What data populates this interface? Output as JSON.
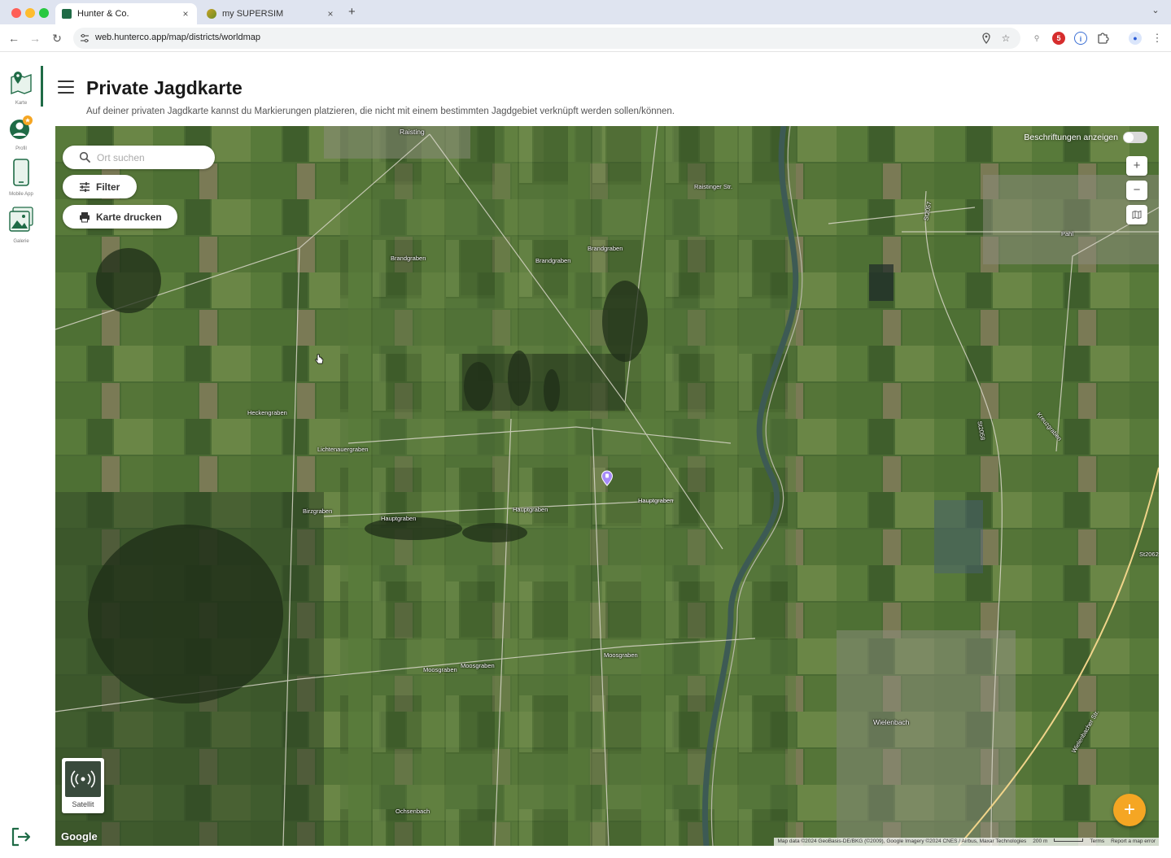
{
  "browser": {
    "tabs": [
      {
        "title": "Hunter & Co.",
        "active": true
      },
      {
        "title": "my SUPERSIM",
        "active": false
      }
    ],
    "new_tab": "+",
    "close_glyph": "×",
    "url": "web.hunterco.app/map/districts/worldmap"
  },
  "sidenav": {
    "items": [
      {
        "label": "Karte",
        "icon": "map-pin-icon",
        "active": true
      },
      {
        "label": "Profil",
        "icon": "user-profile-icon",
        "active": false
      },
      {
        "label": "Mobile App",
        "icon": "smartphone-icon",
        "active": false
      },
      {
        "label": "Galerie",
        "icon": "gallery-icon",
        "active": false
      }
    ],
    "logout_icon": "logout-icon"
  },
  "header": {
    "title": "Private Jagdkarte",
    "description": "Auf deiner privaten Jagdkarte kannst du Markierungen platzieren, die nicht mit einem bestimmten Jagdgebiet verknüpft werden sollen/können."
  },
  "map": {
    "search_placeholder": "Ort suchen",
    "filter_label": "Filter",
    "print_label": "Karte drucken",
    "labels_toggle_label": "Beschriftungen anzeigen",
    "labels_toggle_on": false,
    "zoom_in": "+",
    "zoom_out": "−",
    "layer_type_label": "Satellit",
    "google_logo": "Google",
    "attribution": "Map data ©2024 GeoBasis-DE/BKG (©2009), Google Imagery ©2024 CNES / Airbus, Maxar Technologies",
    "scale": "200 m",
    "terms": "Terms",
    "report": "Report a map error",
    "fab_label": "+",
    "place_labels": {
      "raisting": "Raisting",
      "wielenbach": "Wielenbach",
      "pahl": "Pahl"
    },
    "road_labels": {
      "raistinger_str": "Raistinger Str.",
      "brandgraben_1": "Brandgraben",
      "brandgraben_2": "Brandgraben",
      "brandgraben_3": "Brandgraben",
      "hauptgraben_1": "Hauptgraben",
      "hauptgraben_2": "Hauptgraben",
      "hauptgraben_3": "Hauptgraben",
      "mossgraben_1": "Moosgraben",
      "mossgraben_2": "Moosgraben",
      "mossgraben_3": "Moosgraben",
      "lichtenauergraben": "Lichtenauergraben",
      "birzgraben": "Birzgraben",
      "heckengraben": "Heckengraben",
      "ochsenbach": "Ochsenbach",
      "st2057": "St2057",
      "st2058": "St2058",
      "st2062": "St2062",
      "kreuzgraben": "Kreuzgraben",
      "wielenbacher_str": "Wielenbacher Str."
    },
    "colors": {
      "accent": "#1f6b46",
      "fab": "#f5a623",
      "marker": "#a78bfa"
    }
  }
}
